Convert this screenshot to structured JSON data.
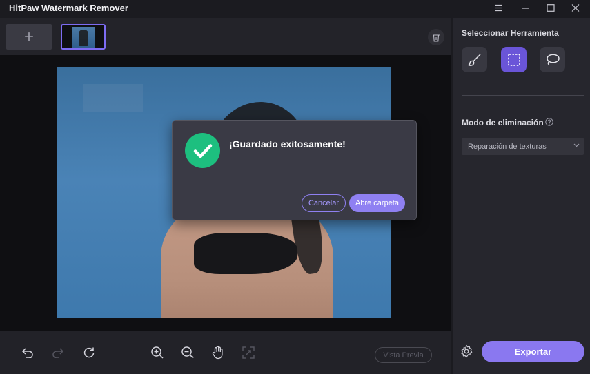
{
  "window": {
    "title": "HitPaw Watermark Remover",
    "controls": [
      "menu-icon",
      "minimize-icon",
      "maximize-icon",
      "close-icon"
    ]
  },
  "strip": {
    "add_label": "+"
  },
  "dialog": {
    "message": "¡Guardado exitosamente!",
    "cancel_label": "Cancelar",
    "open_label": "Abre carpeta"
  },
  "toolbar": {
    "tools": [
      "undo-icon",
      "redo-icon",
      "reset-icon",
      "zoom-in-icon",
      "zoom-out-icon",
      "hand-icon",
      "fit-icon"
    ],
    "preview_label": "Vista Previa"
  },
  "panel": {
    "tool_title": "Seleccionar Herramienta",
    "tools": [
      {
        "name": "brush-icon",
        "active": false
      },
      {
        "name": "rect-select-icon",
        "active": true
      },
      {
        "name": "lasso-icon",
        "active": false
      }
    ],
    "mode_label": "Modo de eliminación",
    "mode_value": "Reparación de texturas",
    "export_label": "Exportar"
  },
  "colors": {
    "accent": "#8a78f0",
    "success": "#1dbf7f",
    "background": "#1b1b20"
  }
}
